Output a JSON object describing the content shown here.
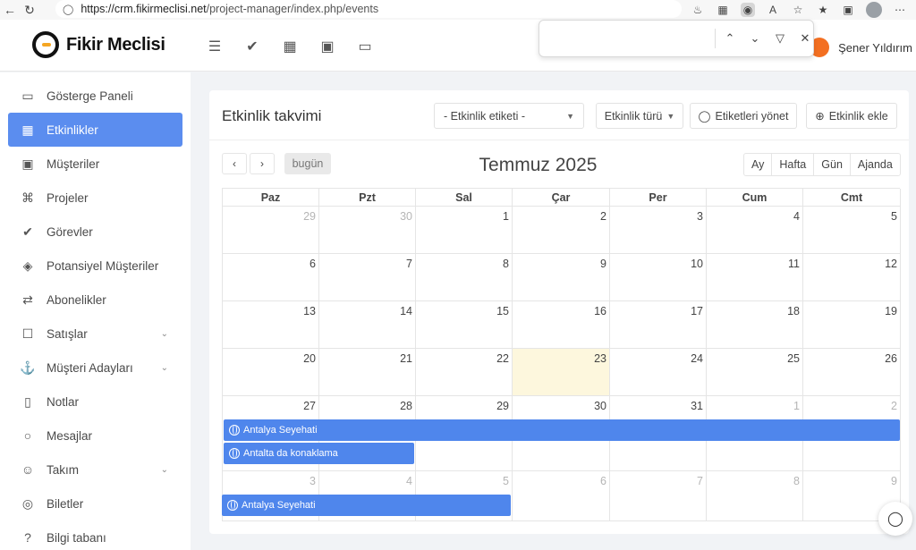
{
  "browser": {
    "url_host": "https://crm.fikirmeclisi.net",
    "url_path": "/project-manager/index.php/events"
  },
  "header": {
    "logo_text": "Fikir Meclisi",
    "user_name": "Şener Yıldırım"
  },
  "findbar": {
    "value": ""
  },
  "sidebar": {
    "items": [
      {
        "label": "Gösterge Paneli",
        "icon": "monitor-icon",
        "active": false,
        "chevron": false
      },
      {
        "label": "Etkinlikler",
        "icon": "calendar-icon",
        "active": true,
        "chevron": false
      },
      {
        "label": "Müşteriler",
        "icon": "briefcase-icon",
        "active": false,
        "chevron": false
      },
      {
        "label": "Projeler",
        "icon": "command-icon",
        "active": false,
        "chevron": false
      },
      {
        "label": "Görevler",
        "icon": "check-circle-icon",
        "active": false,
        "chevron": false
      },
      {
        "label": "Potansiyel Müşteriler",
        "icon": "layers-icon",
        "active": false,
        "chevron": false
      },
      {
        "label": "Abonelikler",
        "icon": "repeat-icon",
        "active": false,
        "chevron": false
      },
      {
        "label": "Satışlar",
        "icon": "cart-icon",
        "active": false,
        "chevron": true
      },
      {
        "label": "Müşteri Adayları",
        "icon": "anchor-icon",
        "active": false,
        "chevron": true
      },
      {
        "label": "Notlar",
        "icon": "book-icon",
        "active": false,
        "chevron": false
      },
      {
        "label": "Mesajlar",
        "icon": "message-icon",
        "active": false,
        "chevron": false
      },
      {
        "label": "Takım",
        "icon": "users-icon",
        "active": false,
        "chevron": true
      },
      {
        "label": "Biletler",
        "icon": "lifebuoy-icon",
        "active": false,
        "chevron": false
      },
      {
        "label": "Bilgi tabanı",
        "icon": "help-icon",
        "active": false,
        "chevron": false
      }
    ]
  },
  "panel": {
    "title": "Etkinlik takvimi",
    "tag_select": "- Etkinlik etiketi -",
    "type_button": "Etkinlik türü",
    "manage_tags_button": "Etiketleri yönet",
    "add_event_button": "Etkinlik ekle"
  },
  "calendar": {
    "today_label": "bugün",
    "title": "Temmuz 2025",
    "views": [
      "Ay",
      "Hafta",
      "Gün",
      "Ajanda"
    ],
    "weekdays": [
      "Paz",
      "Pzt",
      "Sal",
      "Çar",
      "Per",
      "Cum",
      "Cmt"
    ],
    "weeks": [
      [
        {
          "d": "29",
          "o": true
        },
        {
          "d": "30",
          "o": true
        },
        {
          "d": "1"
        },
        {
          "d": "2"
        },
        {
          "d": "3"
        },
        {
          "d": "4"
        },
        {
          "d": "5"
        }
      ],
      [
        {
          "d": "6"
        },
        {
          "d": "7"
        },
        {
          "d": "8"
        },
        {
          "d": "9"
        },
        {
          "d": "10"
        },
        {
          "d": "11"
        },
        {
          "d": "12"
        }
      ],
      [
        {
          "d": "13"
        },
        {
          "d": "14"
        },
        {
          "d": "15"
        },
        {
          "d": "16"
        },
        {
          "d": "17"
        },
        {
          "d": "18"
        },
        {
          "d": "19"
        }
      ],
      [
        {
          "d": "20"
        },
        {
          "d": "21"
        },
        {
          "d": "22"
        },
        {
          "d": "23",
          "t": true
        },
        {
          "d": "24"
        },
        {
          "d": "25"
        },
        {
          "d": "26"
        }
      ],
      [
        {
          "d": "27"
        },
        {
          "d": "28"
        },
        {
          "d": "29"
        },
        {
          "d": "30"
        },
        {
          "d": "31"
        },
        {
          "d": "1",
          "o": true
        },
        {
          "d": "2",
          "o": true
        }
      ],
      [
        {
          "d": "3",
          "o": true
        },
        {
          "d": "4",
          "o": true
        },
        {
          "d": "5",
          "o": true
        },
        {
          "d": "6",
          "o": true
        },
        {
          "d": "7",
          "o": true
        },
        {
          "d": "8",
          "o": true
        },
        {
          "d": "9",
          "o": true
        }
      ]
    ],
    "events": [
      {
        "title": "Antalya Seyehati"
      },
      {
        "title": "Antalta da konaklama"
      },
      {
        "title": "Antalya Seyehati"
      }
    ]
  }
}
